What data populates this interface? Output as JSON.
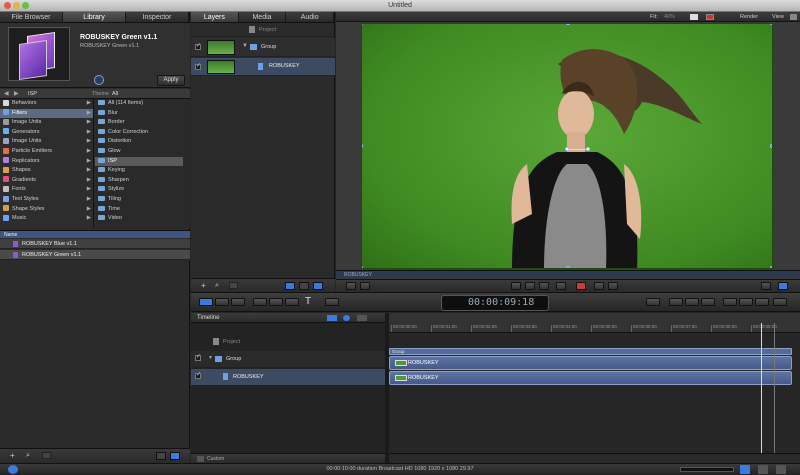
{
  "window": {
    "title": "Untitled"
  },
  "left_tabs": [
    "File Browser",
    "Library",
    "Inspector"
  ],
  "preview": {
    "title": "ROBUSKEY Green v1.1",
    "subtitle": "ROBUSKEY Green v1.1",
    "apply_label": "Apply"
  },
  "path_bar": {
    "location": "ISP",
    "theme_label": "Theme",
    "theme_value": "All"
  },
  "categories": [
    {
      "label": "Behaviors",
      "color": "#d8d8d8"
    },
    {
      "label": "Filters",
      "color": "#6fa0e0",
      "selected": true
    },
    {
      "label": "Image Units",
      "color": "#9a9a9a"
    },
    {
      "label": "Generators",
      "color": "#6ab0e8"
    },
    {
      "label": "Image Units",
      "color": "#a0a0c0"
    },
    {
      "label": "Particle Emitters",
      "color": "#e07040"
    },
    {
      "label": "Replicators",
      "color": "#b080e0"
    },
    {
      "label": "Shapes",
      "color": "#e0a040"
    },
    {
      "label": "Gradients",
      "color": "#e05080"
    },
    {
      "label": "Fonts",
      "color": "#c0c0c0"
    },
    {
      "label": "Text Styles",
      "color": "#80a0e0"
    },
    {
      "label": "Shape Styles",
      "color": "#d0a050"
    },
    {
      "label": "Music",
      "color": "#70a0ff"
    }
  ],
  "subcategories": [
    "All (114 Items)",
    "Blur",
    "Border",
    "Color Correction",
    "Distortion",
    "Glow",
    "ISP",
    "Keying",
    "Sharpen",
    "Stylize",
    "Tiling",
    "Time",
    "Video"
  ],
  "subcategory_selected_index": 6,
  "file_list": {
    "header": "Name",
    "items": [
      "ROBUSKEY Blue v1.1",
      "ROBUSKEY Green v1.1"
    ]
  },
  "middle_tabs": [
    "Layers",
    "Media",
    "Audio"
  ],
  "layers": {
    "project": "Project",
    "group": "Group",
    "layer": "ROBUSKEY"
  },
  "canvas_toolbar": {
    "fit_label": "Fit:",
    "fit_value": "40%",
    "render_label": "Render",
    "view_label": "View"
  },
  "canvas_tab_label": "ROBUSKEY",
  "timecode": "00:00:09:18",
  "timeline": {
    "title": "Timeline",
    "project": "Project",
    "group": "Group",
    "layer": "ROBUSKEY",
    "ruler_ticks": [
      "00:00:00:00",
      "00:00:01:00",
      "00:00:02:00",
      "00:00:03:00",
      "00:00:04:00",
      "00:00:05:00",
      "00:00:06:00",
      "00:00:07:00",
      "00:00:08:00",
      "00:00:09:00"
    ],
    "group_bar_label": "Group",
    "clip1_label": "ROBUSKEY",
    "clip2_label": "ROBUSKEY",
    "bottom_mode": "Custom"
  },
  "status_bar": {
    "text": "00:00:10:00 duration Broadcast HD 1080 1920 x 1080 29.97"
  },
  "colors": {
    "accent": "#3b7be0",
    "green_screen": "#4f9a2b",
    "track": "#5d74a3"
  }
}
